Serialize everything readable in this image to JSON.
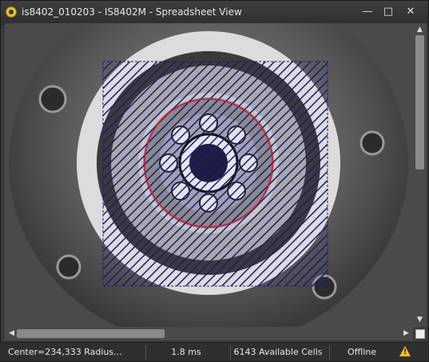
{
  "window": {
    "title": "is8402_010203 - IS8402M - Spreadsheet View",
    "controls": {
      "minimize": "—",
      "maximize": "□",
      "close": "✕"
    }
  },
  "scrollbars": {
    "up_arrow": "▲",
    "down_arrow": "▼",
    "left_arrow": "◀",
    "right_arrow": "▶"
  },
  "statusbar": {
    "center_radius": "Center=234,333 Radius...",
    "timing": "1.8 ms",
    "cells": "6143 Available Cells",
    "connection": "Offline",
    "warning_icon": "warning-icon"
  },
  "colors": {
    "roi_hatch": "#1a1a7a",
    "circle_outline": "#d4143a",
    "warning": "#f2c21b"
  }
}
